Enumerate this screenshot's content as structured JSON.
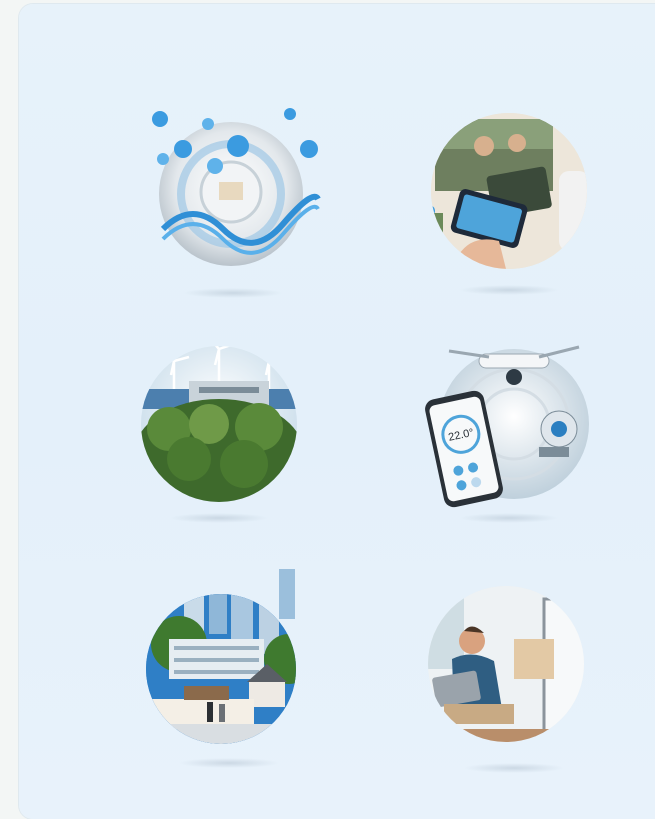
{
  "gallery": {
    "tiles": [
      {
        "icon": "dna-molecule-sphere-illustration"
      },
      {
        "icon": "home-entertainment-sphere-illustration"
      },
      {
        "icon": "renewable-energy-sphere-illustration"
      },
      {
        "icon": "smart-devices-drone-robot-sphere-illustration"
      },
      {
        "icon": "city-buildings-sphere-illustration"
      },
      {
        "icon": "remote-work-laptop-sphere-illustration"
      }
    ],
    "phone_readout": "22.0°"
  }
}
